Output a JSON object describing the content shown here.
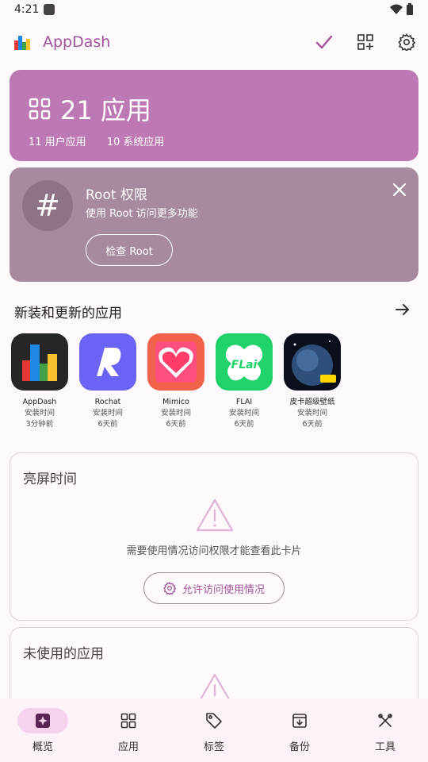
{
  "status": {
    "time": "4:21"
  },
  "app": {
    "title": "AppDash"
  },
  "summary": {
    "count_text": "21 应用",
    "user_apps": "11 用户应用",
    "system_apps": "10 系统应用"
  },
  "root": {
    "title": "Root 权限",
    "desc": "使用 Root 访问更多功能",
    "button": "检查 Root",
    "symbol": "#"
  },
  "recent": {
    "title": "新装和更新的应用",
    "apps": [
      {
        "name": "AppDash",
        "line1": "安装时间",
        "line2": "3分钟前"
      },
      {
        "name": "Rochat",
        "line1": "安装时间",
        "line2": "6天前"
      },
      {
        "name": "Mimico",
        "line1": "安装时间",
        "line2": "6天前"
      },
      {
        "name": "FLAI",
        "line1": "安装时间",
        "line2": "6天前"
      },
      {
        "name": "皮卡超级壁纸",
        "line1": "安装时间",
        "line2": "6天前"
      }
    ]
  },
  "screen_time": {
    "title": "亮屏时间",
    "message": "需要使用情况访问权限才能查看此卡片",
    "button": "允许访问使用情况"
  },
  "unused": {
    "title": "未使用的应用"
  },
  "nav": [
    {
      "label": "概览"
    },
    {
      "label": "应用"
    },
    {
      "label": "标签"
    },
    {
      "label": "备份"
    },
    {
      "label": "工具"
    }
  ],
  "colors": {
    "accent": "#a0559b",
    "hero": "#bd79b3",
    "root_card": "#a78a9e",
    "nav_active": "#f5d3ec"
  }
}
